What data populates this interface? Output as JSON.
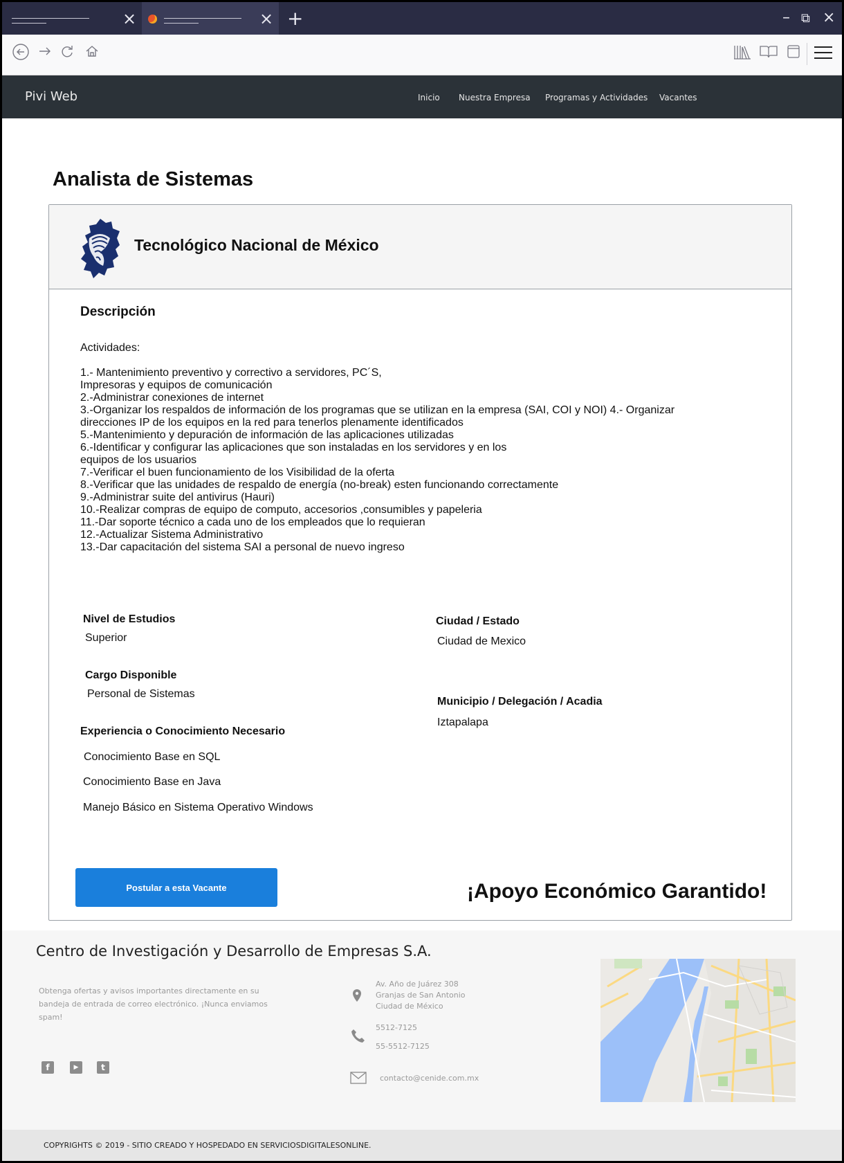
{
  "browser": {
    "tab_close_glyph": "×",
    "new_tab_glyph": "+",
    "window_controls": {
      "minimize": "–",
      "restore": "⧉",
      "close": "×"
    },
    "toolbar_icons": [
      "back-icon",
      "forward-icon",
      "reload-icon",
      "home-icon",
      "library-icon",
      "reader-icon",
      "sidebar-icon",
      "menu-icon"
    ]
  },
  "site_nav": {
    "brand": "Pivi Web",
    "links": [
      "Inicio",
      "Nuestra Empresa",
      "Programas y Actividades",
      "Vacantes"
    ]
  },
  "job": {
    "title": "Analista de Sistemas",
    "company": "Tecnológico Nacional de México",
    "description_title": "Descripción",
    "activities_label": "Actividades:",
    "activities": [
      "1.- Mantenimiento preventivo y correctivo a servidores, PC´S,",
      "Impresoras y equipos de comunicación",
      "2.-Administrar conexiones de internet",
      "3.-Organizar los respaldos de información de los programas que se utilizan en la empresa (SAI, COI y NOI) 4.- Organizar",
      "direcciones IP de los equipos en la red para tenerlos plenamente identificados",
      "5.-Mantenimiento y depuración de información de las aplicaciones utilizadas",
      "6.-Identificar y configurar las aplicaciones que son instaladas en los servidores y en los",
      "equipos de los usuarios",
      "7.-Verificar el buen funcionamiento de los Visibilidad de la oferta",
      "8.-Verificar que las unidades de respaldo de energía (no-break) esten funcionando correctamente",
      "9.-Administrar suite del antivirus (Hauri)",
      "10.-Realizar compras de equipo de computo, accesorios ,consumibles y papeleria",
      "11.-Dar soporte técnico a cada uno de los empleados que lo requieran",
      "12.-Actualizar Sistema Administrativo",
      "13.-Dar capacitación del sistema SAI a personal de nuevo ingreso"
    ],
    "education_label": "Nivel de Estudios",
    "education": "Superior",
    "position_label": "Cargo Disponible",
    "position": "Personal de Sistemas",
    "experience_label": "Experiencia o Conocimiento Necesario",
    "experience": [
      "Conocimiento Base en SQL",
      "Conocimiento Base en Java",
      "Manejo Básico en Sistema Operativo Windows"
    ],
    "city_label": "Ciudad / Estado",
    "city": "Ciudad de Mexico",
    "municipality_label": "Municipio / Delegación / Acadia",
    "municipality": "Iztapalapa",
    "apply_button": "Postular a esta Vacante",
    "guarantee": "¡Apoyo Económico Garantido!"
  },
  "footer": {
    "title": "Centro de Investigación y Desarrollo de Empresas S.A.",
    "newsletter": "Obtenga ofertas y avisos importantes directamente en su bandeja de entrada de correo electrónico. ¡Nunca enviamos spam!",
    "social": [
      {
        "name": "facebook-icon",
        "glyph": "f"
      },
      {
        "name": "youtube-icon",
        "glyph": "▶"
      },
      {
        "name": "twitter-icon",
        "glyph": "t"
      }
    ],
    "address": [
      "Av. Año de Juárez 308",
      "Granjas de San Antonio",
      "Ciudad de México"
    ],
    "phones": [
      "5512-7125",
      "55-5512-7125"
    ],
    "email": "contacto@cenide.com.mx",
    "copyright": "COPYRIGHTS © 2019 - SITIO CREADO Y HOSPEDADO EN SERVICIOSDIGITALESONLINE."
  },
  "colors": {
    "browser_tabbar": "#2a2c44",
    "site_nav": "#2b3238",
    "accent_button": "#1a7fdc",
    "footer_bg": "#f6f6f6",
    "copyright_bg": "#e6e6e6"
  }
}
